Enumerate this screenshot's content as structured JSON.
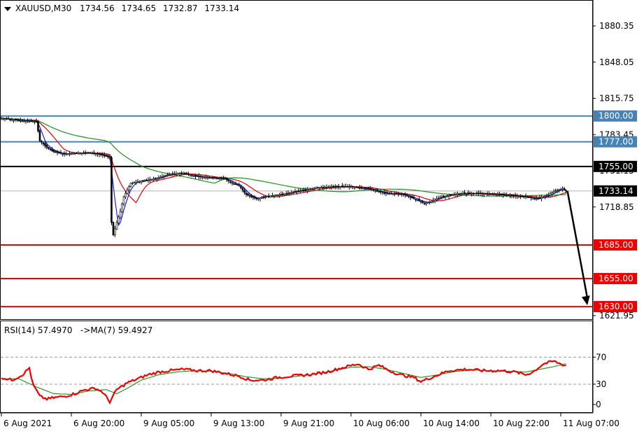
{
  "header": {
    "symbol_label": "XAUUSD,M30",
    "ohlc": [
      "1734.56",
      "1734.65",
      "1732.87",
      "1733.14"
    ]
  },
  "colors": {
    "background": "#ffffff",
    "candle": "#000000",
    "ma_fast": "#1a1aff",
    "ma_mid": "#e00000",
    "ma_slow": "#1f8f1f",
    "resistance_blue": "#4682b4",
    "pivot_black": "#000000",
    "support_red": "#ee0000",
    "rsi_line": "#ee0000",
    "rsi_ma": "#1f8f1f",
    "rsi_level": "#9a9a9a",
    "current_price_line": "#b0b0b0"
  },
  "rsi_header": "RSI(14) 57.4970   ->MA(7) 59.4927",
  "chart_data": [
    {
      "type": "candlestick",
      "title": "XAUUSD,M30",
      "ylim": [
        1621.95,
        1880.35
      ],
      "y_ticks": [
        "1880.35",
        "1848.05",
        "1815.75",
        "1783.45",
        "1751.15",
        "1718.85",
        "1621.95"
      ],
      "x_ticks": [
        "6 Aug 2021",
        "6 Aug 20:00",
        "9 Aug 05:00",
        "9 Aug 13:00",
        "9 Aug 21:00",
        "10 Aug 06:00",
        "10 Aug 14:00",
        "10 Aug 22:00",
        "11 Aug 07:00"
      ],
      "current_price": 1733.14,
      "current_price_label": "1733.14",
      "levels": [
        {
          "value": 1800.0,
          "label": "1800.00",
          "kind": "resistance"
        },
        {
          "value": 1777.0,
          "label": "1777.00",
          "kind": "resistance"
        },
        {
          "value": 1755.0,
          "label": "1755.00",
          "kind": "pivot"
        },
        {
          "value": 1685.0,
          "label": "1685.00",
          "kind": "support"
        },
        {
          "value": 1655.0,
          "label": "1655.00",
          "kind": "support"
        },
        {
          "value": 1630.0,
          "label": "1630.00",
          "kind": "support"
        }
      ],
      "forecast_arrow": {
        "from_price": 1733.14,
        "to_price": 1630.0
      },
      "close_path_knots": [
        [
          0,
          1798
        ],
        [
          10,
          1796
        ],
        [
          20,
          1795
        ],
        [
          22,
          1778
        ],
        [
          26,
          1772
        ],
        [
          30,
          1768
        ],
        [
          36,
          1766
        ],
        [
          44,
          1767
        ],
        [
          52,
          1767
        ],
        [
          58,
          1765
        ],
        [
          62,
          1763
        ],
        [
          63,
          1705
        ],
        [
          64,
          1694
        ],
        [
          66,
          1705
        ],
        [
          68,
          1715
        ],
        [
          70,
          1728
        ],
        [
          74,
          1740
        ],
        [
          80,
          1742
        ],
        [
          88,
          1744
        ],
        [
          96,
          1748
        ],
        [
          104,
          1749
        ],
        [
          112,
          1746
        ],
        [
          120,
          1745
        ],
        [
          128,
          1744
        ],
        [
          132,
          1740
        ],
        [
          136,
          1738
        ],
        [
          140,
          1730
        ],
        [
          146,
          1726
        ],
        [
          150,
          1728
        ],
        [
          160,
          1730
        ],
        [
          170,
          1733
        ],
        [
          180,
          1736
        ],
        [
          190,
          1737
        ],
        [
          200,
          1737
        ],
        [
          210,
          1735
        ],
        [
          220,
          1731
        ],
        [
          230,
          1730
        ],
        [
          238,
          1725
        ],
        [
          242,
          1722
        ],
        [
          246,
          1724
        ],
        [
          252,
          1728
        ],
        [
          262,
          1731
        ],
        [
          272,
          1731
        ],
        [
          282,
          1730
        ],
        [
          292,
          1729
        ],
        [
          300,
          1728
        ],
        [
          306,
          1726
        ],
        [
          312,
          1729
        ],
        [
          318,
          1734
        ],
        [
          321,
          1735
        ],
        [
          323,
          1733
        ]
      ],
      "series": [
        {
          "name": "MA fast",
          "values_from": "close_path",
          "period": 5
        },
        {
          "name": "MA mid",
          "values_from": "close_path",
          "period": 15
        },
        {
          "name": "MA slow",
          "values_from": "close_path",
          "period": 60
        }
      ]
    },
    {
      "type": "line",
      "title": "RSI(14) 57.4970 ->MA(7) 59.4927",
      "ylim": [
        0,
        100
      ],
      "y_ticks": [
        "70",
        "30",
        "0"
      ],
      "levels": [
        70,
        30
      ],
      "rsi_knots": [
        [
          0,
          40
        ],
        [
          6,
          36
        ],
        [
          12,
          44
        ],
        [
          16,
          54
        ],
        [
          18,
          30
        ],
        [
          22,
          12
        ],
        [
          26,
          8
        ],
        [
          30,
          10
        ],
        [
          36,
          12
        ],
        [
          42,
          16
        ],
        [
          48,
          22
        ],
        [
          54,
          24
        ],
        [
          58,
          18
        ],
        [
          62,
          4
        ],
        [
          66,
          22
        ],
        [
          72,
          32
        ],
        [
          78,
          38
        ],
        [
          84,
          44
        ],
        [
          90,
          48
        ],
        [
          96,
          50
        ],
        [
          104,
          52
        ],
        [
          112,
          50
        ],
        [
          120,
          50
        ],
        [
          128,
          46
        ],
        [
          136,
          42
        ],
        [
          142,
          36
        ],
        [
          150,
          36
        ],
        [
          158,
          40
        ],
        [
          166,
          42
        ],
        [
          176,
          44
        ],
        [
          186,
          48
        ],
        [
          196,
          55
        ],
        [
          204,
          60
        ],
        [
          210,
          52
        ],
        [
          216,
          58
        ],
        [
          222,
          50
        ],
        [
          228,
          44
        ],
        [
          236,
          40
        ],
        [
          240,
          34
        ],
        [
          246,
          40
        ],
        [
          256,
          50
        ],
        [
          266,
          52
        ],
        [
          276,
          50
        ],
        [
          286,
          50
        ],
        [
          294,
          48
        ],
        [
          300,
          44
        ],
        [
          304,
          48
        ],
        [
          310,
          60
        ],
        [
          316,
          64
        ],
        [
          320,
          60
        ],
        [
          322,
          58
        ]
      ],
      "rsi_ma_knots": [
        [
          0,
          38
        ],
        [
          10,
          38
        ],
        [
          20,
          26
        ],
        [
          30,
          16
        ],
        [
          40,
          15
        ],
        [
          50,
          20
        ],
        [
          60,
          22
        ],
        [
          66,
          16
        ],
        [
          72,
          24
        ],
        [
          80,
          36
        ],
        [
          90,
          44
        ],
        [
          100,
          48
        ],
        [
          110,
          50
        ],
        [
          120,
          49
        ],
        [
          130,
          46
        ],
        [
          140,
          41
        ],
        [
          150,
          38
        ],
        [
          160,
          39
        ],
        [
          170,
          42
        ],
        [
          180,
          45
        ],
        [
          190,
          50
        ],
        [
          200,
          55
        ],
        [
          210,
          56
        ],
        [
          220,
          52
        ],
        [
          230,
          46
        ],
        [
          240,
          40
        ],
        [
          250,
          44
        ],
        [
          260,
          49
        ],
        [
          270,
          51
        ],
        [
          280,
          50
        ],
        [
          290,
          49
        ],
        [
          300,
          48
        ],
        [
          310,
          53
        ],
        [
          316,
          56
        ],
        [
          322,
          60
        ]
      ]
    }
  ]
}
